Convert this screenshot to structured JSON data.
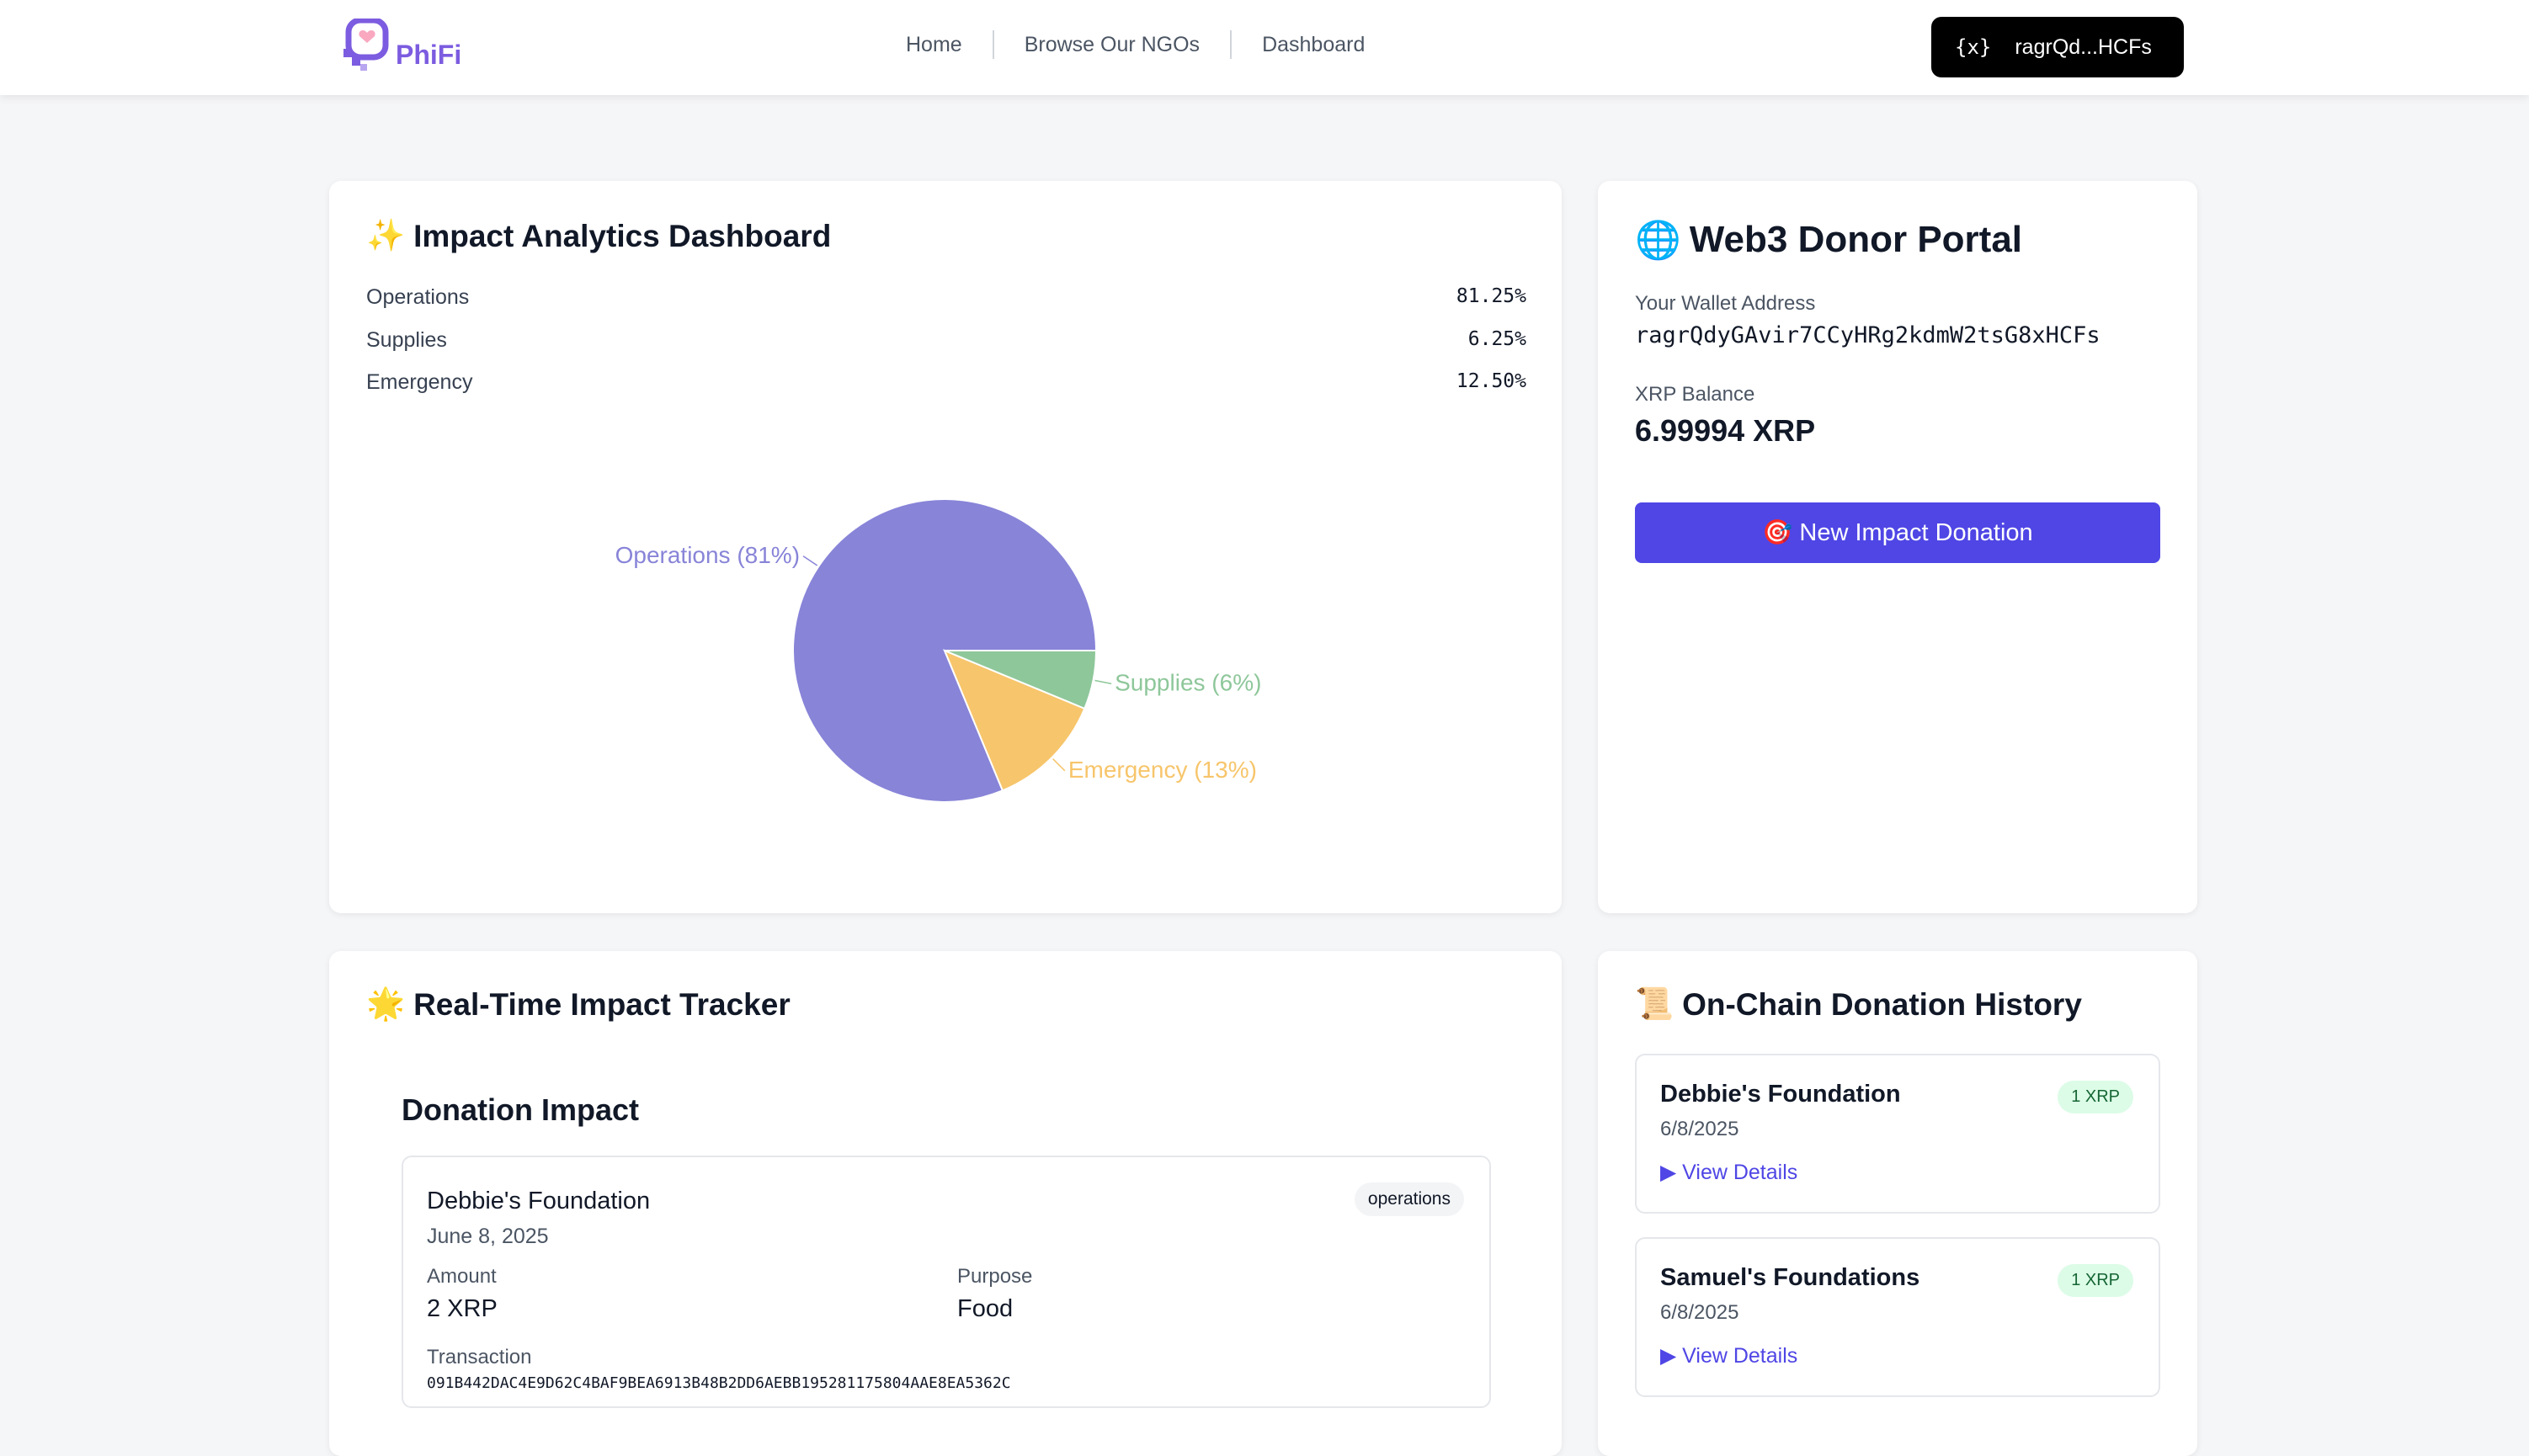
{
  "nav": {
    "logo_text": "PhiFi",
    "links": [
      "Home",
      "Browse Our NGOs",
      "Dashboard"
    ],
    "wallet_icon": "{x}",
    "wallet_short": "ragrQd...HCFs"
  },
  "analytics": {
    "emoji": "✨",
    "title": "Impact Analytics Dashboard",
    "stats": [
      {
        "label": "Operations",
        "value": "81.25%"
      },
      {
        "label": "Supplies",
        "value": "6.25%"
      },
      {
        "label": "Emergency",
        "value": "12.50%"
      }
    ]
  },
  "chart_data": {
    "type": "pie",
    "slices": [
      {
        "name": "Operations",
        "value": 81.25,
        "label": "Operations (81%)",
        "color": "#8884d8"
      },
      {
        "name": "Emergency",
        "value": 12.5,
        "label": "Emergency (13%)",
        "color": "#f7c56b"
      },
      {
        "name": "Supplies",
        "value": 6.25,
        "label": "Supplies (6%)",
        "color": "#8ec79a"
      }
    ]
  },
  "portal": {
    "emoji": "🌐",
    "title": "Web3 Donor Portal",
    "wallet_label": "Your Wallet Address",
    "wallet_address": "ragrQdyGAvir7CCyHRg2kdmW2tsG8xHCFs",
    "balance_label": "XRP Balance",
    "balance_value": "6.99994 XRP",
    "donate_emoji": "🎯",
    "donate_label": "New Impact Donation"
  },
  "tracker": {
    "emoji": "🌟",
    "title": "Real-Time Impact Tracker",
    "section_title": "Donation Impact",
    "item": {
      "org": "Debbie's Foundation",
      "date": "June 8, 2025",
      "badge": "operations",
      "amount_label": "Amount",
      "amount_value": "2 XRP",
      "purpose_label": "Purpose",
      "purpose_value": "Food",
      "tx_label": "Transaction",
      "tx_hash": "091B442DAC4E9D62C4BAF9BEA6913B48B2DD6AEBB195281175804AAE8EA5362C"
    }
  },
  "history": {
    "emoji": "📜",
    "title": "On-Chain Donation History",
    "items": [
      {
        "name": "Debbie's Foundation",
        "date": "6/8/2025",
        "amount": "1 XRP",
        "link": "View Details"
      },
      {
        "name": "Samuel's Foundations",
        "date": "6/8/2025",
        "amount": "1 XRP",
        "link": "View Details"
      }
    ]
  },
  "colors": {
    "accent": "#4f46e5",
    "brand": "#7c5ce0"
  }
}
